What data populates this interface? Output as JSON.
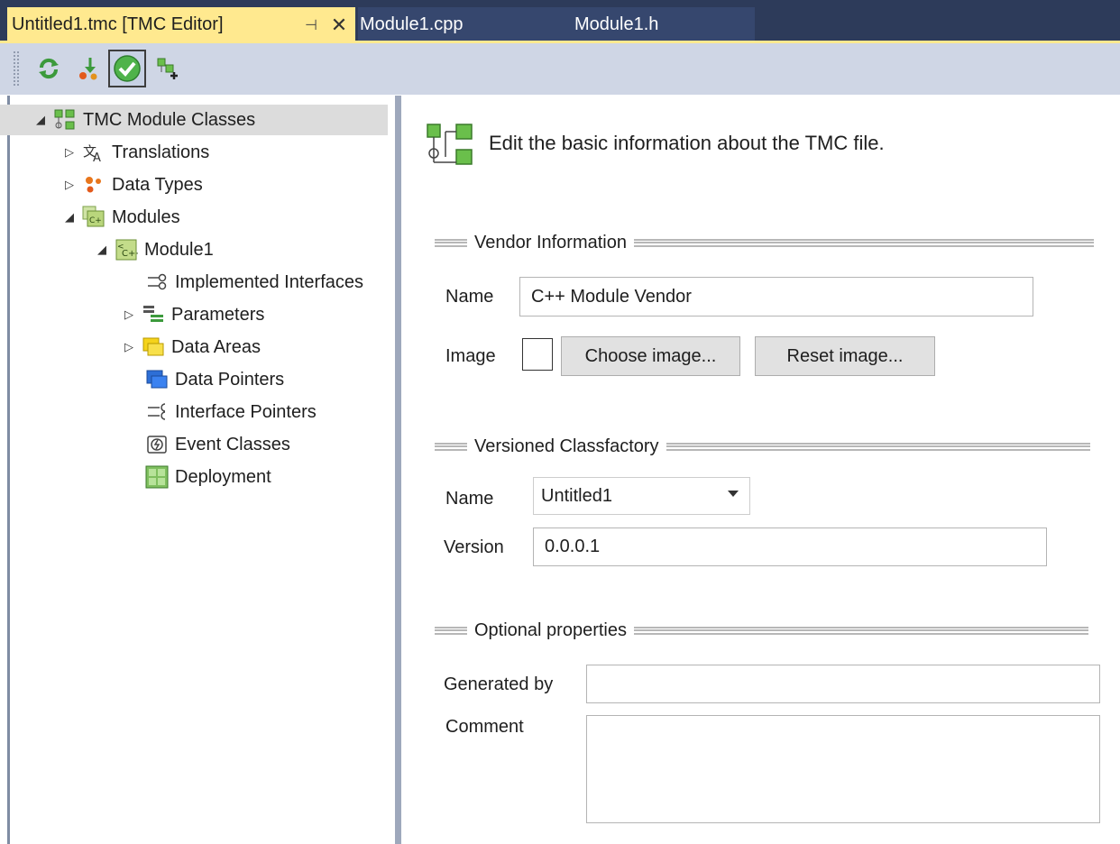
{
  "tabs": [
    {
      "label": "Untitled1.tmc [TMC Editor]",
      "active": true,
      "pin_glyph": "⊣",
      "close_glyph": "✕"
    },
    {
      "label": "Module1.cpp",
      "active": false
    },
    {
      "label": "Module1.h",
      "active": false
    }
  ],
  "toolbar": {
    "buttons": [
      {
        "icon": "refresh-icon"
      },
      {
        "icon": "import-icon"
      },
      {
        "icon": "check-icon",
        "pressed": true
      },
      {
        "icon": "add-module-icon"
      }
    ]
  },
  "tree": {
    "root": {
      "label": "TMC Module Classes",
      "icon": "module-classes-icon",
      "expanded": true
    },
    "translations": {
      "label": "Translations",
      "icon": "translations-icon",
      "expanded": false
    },
    "data_types": {
      "label": "Data Types",
      "icon": "data-types-icon",
      "expanded": false
    },
    "modules": {
      "label": "Modules",
      "icon": "modules-icon",
      "expanded": true
    },
    "module1": {
      "label": "Module1",
      "icon": "module-icon",
      "expanded": true
    },
    "implemented_interfaces": {
      "label": "Implemented Interfaces",
      "icon": "interfaces-icon"
    },
    "parameters": {
      "label": "Parameters",
      "icon": "parameters-icon",
      "expanded": false
    },
    "data_areas": {
      "label": "Data Areas",
      "icon": "data-areas-icon",
      "expanded": false
    },
    "data_pointers": {
      "label": "Data Pointers",
      "icon": "data-pointers-icon"
    },
    "interface_pointers": {
      "label": "Interface Pointers",
      "icon": "interface-pointers-icon"
    },
    "event_classes": {
      "label": "Event Classes",
      "icon": "event-classes-icon"
    },
    "deployment": {
      "label": "Deployment",
      "icon": "deployment-icon"
    }
  },
  "header": {
    "text": "Edit the basic information about the TMC file.",
    "icon": "tmc-file-icon"
  },
  "vendor": {
    "title": "Vendor Information",
    "name_label": "Name",
    "name_value": "C++ Module Vendor",
    "image_label": "Image",
    "choose_button": "Choose image...",
    "reset_button": "Reset image..."
  },
  "classfactory": {
    "title": "Versioned Classfactory",
    "name_label": "Name",
    "name_value": "Untitled1",
    "version_label": "Version",
    "version_value": "0.0.0.1"
  },
  "optional": {
    "title": "Optional properties",
    "generated_by_label": "Generated by",
    "generated_by_value": "",
    "comment_label": "Comment",
    "comment_value": ""
  },
  "colors": {
    "active_tab": "#ffe98f",
    "tab_bar": "#2d3b5a",
    "toolbar": "#cfd6e5",
    "selection": "#dcdcdc"
  }
}
